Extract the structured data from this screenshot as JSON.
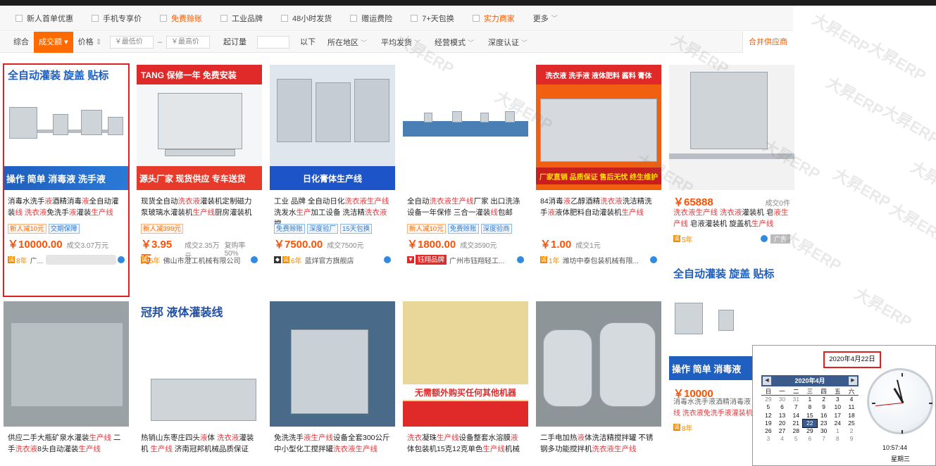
{
  "filters_row1": [
    {
      "label": "新人首单优惠",
      "style": "normal",
      "dropdown": false
    },
    {
      "label": "手机专享价",
      "style": "normal",
      "dropdown": false
    },
    {
      "label": "免费赊账",
      "style": "orange",
      "dropdown": false
    },
    {
      "label": "工业品牌",
      "style": "normal",
      "dropdown": false
    },
    {
      "label": "48小时发货",
      "style": "normal",
      "dropdown": false
    },
    {
      "label": "赠运费险",
      "style": "normal",
      "dropdown": false
    },
    {
      "label": "7+天包换",
      "style": "normal",
      "dropdown": false
    },
    {
      "label": "实力商家",
      "style": "orange",
      "dropdown": false
    },
    {
      "label": "更多",
      "style": "normal",
      "dropdown": true
    }
  ],
  "sort_bar": {
    "comprehensive": "综合",
    "volume": "成交额",
    "price": "价格",
    "price_min_placeholder": "￥最低价",
    "price_max_placeholder": "￥最高价",
    "price_dash": "–",
    "min_order_label": "起订量",
    "min_order_suffix": "以下",
    "region": "所在地区",
    "avg_ship": "平均发货",
    "business_mode": "经营模式",
    "deep_cert": "深度认证",
    "merge_suppliers": "合并供应商"
  },
  "products_row1": [
    {
      "banner_top": "全自动灌装 旋盖 贴标",
      "banner_bottom": "操作 简单 消毒液 洗手液",
      "title_parts": [
        [
          "消毒水洗手",
          ""
        ],
        [
          "液",
          "hl"
        ],
        [
          "酒精消毒",
          ""
        ],
        [
          "液",
          "hl"
        ],
        [
          "全自动灌装",
          ""
        ],
        [
          "线 洗衣液",
          "hl"
        ],
        [
          "免洗手",
          ""
        ],
        [
          "液",
          "hl"
        ],
        [
          "灌装",
          ""
        ],
        [
          "生产线",
          "hl"
        ]
      ],
      "tags": [
        {
          "t": "新人减10元",
          "c": "o"
        },
        {
          "t": "交期保障",
          "c": "b"
        }
      ],
      "price": "￥10000.00",
      "deal": "成交3.07万元",
      "rate": "",
      "years": "8年",
      "seller": "广..."
    },
    {
      "banner_top": "TANG  保修一年 免费安装",
      "banner_bottom": "源头厂家  现货供应 专车送货",
      "title_parts": [
        [
          "现货全自动",
          ""
        ],
        [
          "洗衣液",
          "hl"
        ],
        [
          "灌装机定制磁力泵玻璃水灌装机",
          ""
        ],
        [
          "生产线",
          "hl"
        ],
        [
          "厨房灌装机",
          ""
        ]
      ],
      "tags": [
        {
          "t": "新人减399元",
          "c": "o"
        }
      ],
      "price": "￥3.95万",
      "deal": "成交2.35万元",
      "rate": "复购率50%",
      "years": "5年",
      "seller": "佛山市澄工机械有限公司"
    },
    {
      "banner_top": "",
      "banner_bottom": "日化膏体生产线",
      "title_parts": [
        [
          "工业 品牌 全自动日化",
          ""
        ],
        [
          "洗衣液生产线",
          "hl"
        ],
        [
          "洗发水",
          ""
        ],
        [
          "生产",
          "hl"
        ],
        [
          "加工设备 洗洁精",
          ""
        ],
        [
          "洗衣液",
          "hl"
        ],
        [
          "搅",
          ""
        ]
      ],
      "tags": [
        {
          "t": "免费赊账",
          "c": "b"
        },
        {
          "t": "深度验厂",
          "c": "b"
        },
        {
          "t": "15天包换",
          "c": "b"
        }
      ],
      "price": "￥7500.00",
      "deal": "成交7500元",
      "rate": "",
      "years": "6年",
      "seller": "蓝烊官方旗舰店"
    },
    {
      "banner_top": "",
      "banner_bottom": "",
      "title_parts": [
        [
          "全自动",
          ""
        ],
        [
          "洗衣液生产线",
          "hl"
        ],
        [
          "厂家 出口洗涤设备一年保修 三合一灌装",
          ""
        ],
        [
          "线",
          "hl"
        ],
        [
          "包邮",
          ""
        ]
      ],
      "tags": [
        {
          "t": "新人减10元",
          "c": "o"
        },
        {
          "t": "免费赊账",
          "c": "b"
        },
        {
          "t": "深度验商",
          "c": "b"
        }
      ],
      "price": "￥1800.00",
      "deal": "成交3590元",
      "rate": "",
      "years": "",
      "seller": "广州市钰翔轻工..."
    },
    {
      "banner_top": "洗衣液 洗手液 液体肥料 酱料 膏体",
      "banner_bottom": "厂家直销 品质保证 售后无忧 终生维护",
      "title_parts": [
        [
          "84消毒",
          ""
        ],
        [
          "液",
          "hl"
        ],
        [
          "乙醇酒精",
          ""
        ],
        [
          "洗衣液",
          "hl"
        ],
        [
          "洗洁精洗手",
          ""
        ],
        [
          "液",
          "hl"
        ],
        [
          "液体肥料自动灌装机",
          ""
        ],
        [
          "生产线",
          "hl"
        ]
      ],
      "tags": [],
      "price": "￥1.00",
      "deal": "成交1元",
      "rate": "",
      "years": "1年",
      "seller": "潍坊中泰包装机械有限..."
    }
  ],
  "products_row2": [
    {
      "title_parts": [
        [
          "供应二手大瓶矿泉水灌装",
          ""
        ],
        [
          "生产线",
          "hl"
        ],
        [
          " 二手",
          ""
        ],
        [
          "洗衣液",
          "hl"
        ],
        [
          "8头自动灌装",
          ""
        ],
        [
          "生产线",
          "hl"
        ]
      ]
    },
    {
      "banner_top": "冠邦 液体灌装线",
      "title_parts": [
        [
          "热销山东枣庄四头",
          ""
        ],
        [
          "液",
          "hl"
        ],
        [
          "体 ",
          ""
        ],
        [
          "洗衣液",
          "hl"
        ],
        [
          "灌装机 ",
          ""
        ],
        [
          "生产线",
          "hl"
        ],
        [
          " 济南冠邦机械品质保证",
          ""
        ]
      ]
    },
    {
      "title_parts": [
        [
          "免洗洗手",
          ""
        ],
        [
          "液生产线",
          "hl"
        ],
        [
          "设备全套300公斤中小型化工搅拌罐",
          ""
        ],
        [
          "洗衣液生产线",
          "hl"
        ]
      ]
    },
    {
      "banner_bottom": "无需额外购买任何其他机器",
      "title_parts": [
        [
          "洗衣",
          "hl"
        ],
        [
          "凝珠",
          ""
        ],
        [
          "生产线",
          "hl"
        ],
        [
          "设备整套水溶膜",
          ""
        ],
        [
          "液",
          "hl"
        ],
        [
          "体包装机15克12克单色",
          ""
        ],
        [
          "生产线",
          "hl"
        ],
        [
          "机械",
          ""
        ]
      ]
    },
    {
      "title_parts": [
        [
          "二手电加热",
          ""
        ],
        [
          "液",
          "hl"
        ],
        [
          "体洗洁精搅拌罐 不锈钢多功能搅拌机",
          ""
        ],
        [
          "洗衣液",
          "hl"
        ],
        [
          "生产线",
          "hl"
        ]
      ]
    }
  ],
  "side_ad": {
    "price": "￥65888",
    "deal": "成交0件",
    "title_parts": [
      [
        "洗衣液生产线 洗衣液",
        "hl"
      ],
      [
        "灌装机 皂",
        ""
      ],
      [
        "液生产线",
        "hl"
      ],
      [
        " 皂液灌装机 旋盖机",
        ""
      ],
      [
        "生产线",
        "hl"
      ]
    ],
    "years": "5年",
    "ad_label": "广告",
    "banner2_top": "全自动灌装 旋盖 贴标",
    "banner2_bottom": "操作 简单 消毒液",
    "price2": "￥10000",
    "title2": "消毒水洗手液酒精消毒液",
    "title2b": "线 洗衣液免洗手液灌装机",
    "years2": "8年"
  },
  "calendar": {
    "date_text": "2020年4月22日",
    "month_label": "2020年4月",
    "weekdays": [
      "日",
      "一",
      "二",
      "三",
      "四",
      "五",
      "六"
    ],
    "weeks": [
      [
        29,
        30,
        31,
        1,
        2,
        3,
        4
      ],
      [
        5,
        6,
        7,
        8,
        9,
        10,
        11
      ],
      [
        12,
        13,
        14,
        15,
        16,
        17,
        18
      ],
      [
        19,
        20,
        21,
        22,
        23,
        24,
        25
      ],
      [
        26,
        27,
        28,
        29,
        30,
        1,
        2
      ],
      [
        3,
        4,
        5,
        6,
        7,
        8,
        9
      ]
    ],
    "today": 22,
    "time": "10:57:44",
    "weekday": "星期三"
  },
  "watermark": "大昇ERP"
}
